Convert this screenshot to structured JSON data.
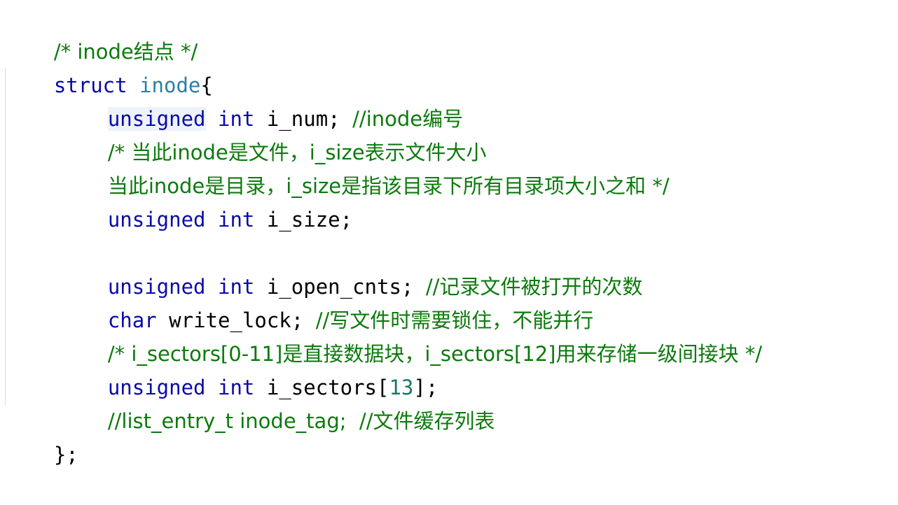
{
  "code": {
    "line1": {
      "comment": "/* inode结点 */"
    },
    "line2": {
      "kw_struct": "struct",
      "name": "inode",
      "brace": "{"
    },
    "line3": {
      "kw_unsigned": "unsigned",
      "kw_int": "int",
      "ident": "i_num;",
      "comment": "//inode编号"
    },
    "line4": {
      "comment": "/* 当此inode是文件，i_size表示文件大小"
    },
    "line5": {
      "comment": "当此inode是目录，i_size是指该目录下所有目录项大小之和 */"
    },
    "line6": {
      "kw_unsigned": "unsigned",
      "kw_int": "int",
      "ident": "i_size;"
    },
    "line8": {
      "kw_unsigned": "unsigned",
      "kw_int": "int",
      "ident": "i_open_cnts;",
      "comment": "//记录文件被打开的次数"
    },
    "line9": {
      "kw_char": "char",
      "ident": "write_lock;",
      "comment": "//写文件时需要锁住，不能并行"
    },
    "line10": {
      "comment": "/* i_sectors[0-11]是直接数据块，i_sectors[12]用来存储一级间接块 */"
    },
    "line11": {
      "kw_unsigned": "unsigned",
      "kw_int": "int",
      "ident": "i_sectors[",
      "num": "13",
      "close": "];"
    },
    "line12": {
      "comment": "//list_entry_t inode_tag;  //文件缓存列表"
    },
    "line13": {
      "close": "};"
    }
  },
  "colors": {
    "keyword": "#0a0aa8",
    "type_name": "#2b7fa6",
    "comment": "#0c7a0c",
    "number": "#1a7a6e",
    "current_line_highlight": "#eef3fa"
  }
}
